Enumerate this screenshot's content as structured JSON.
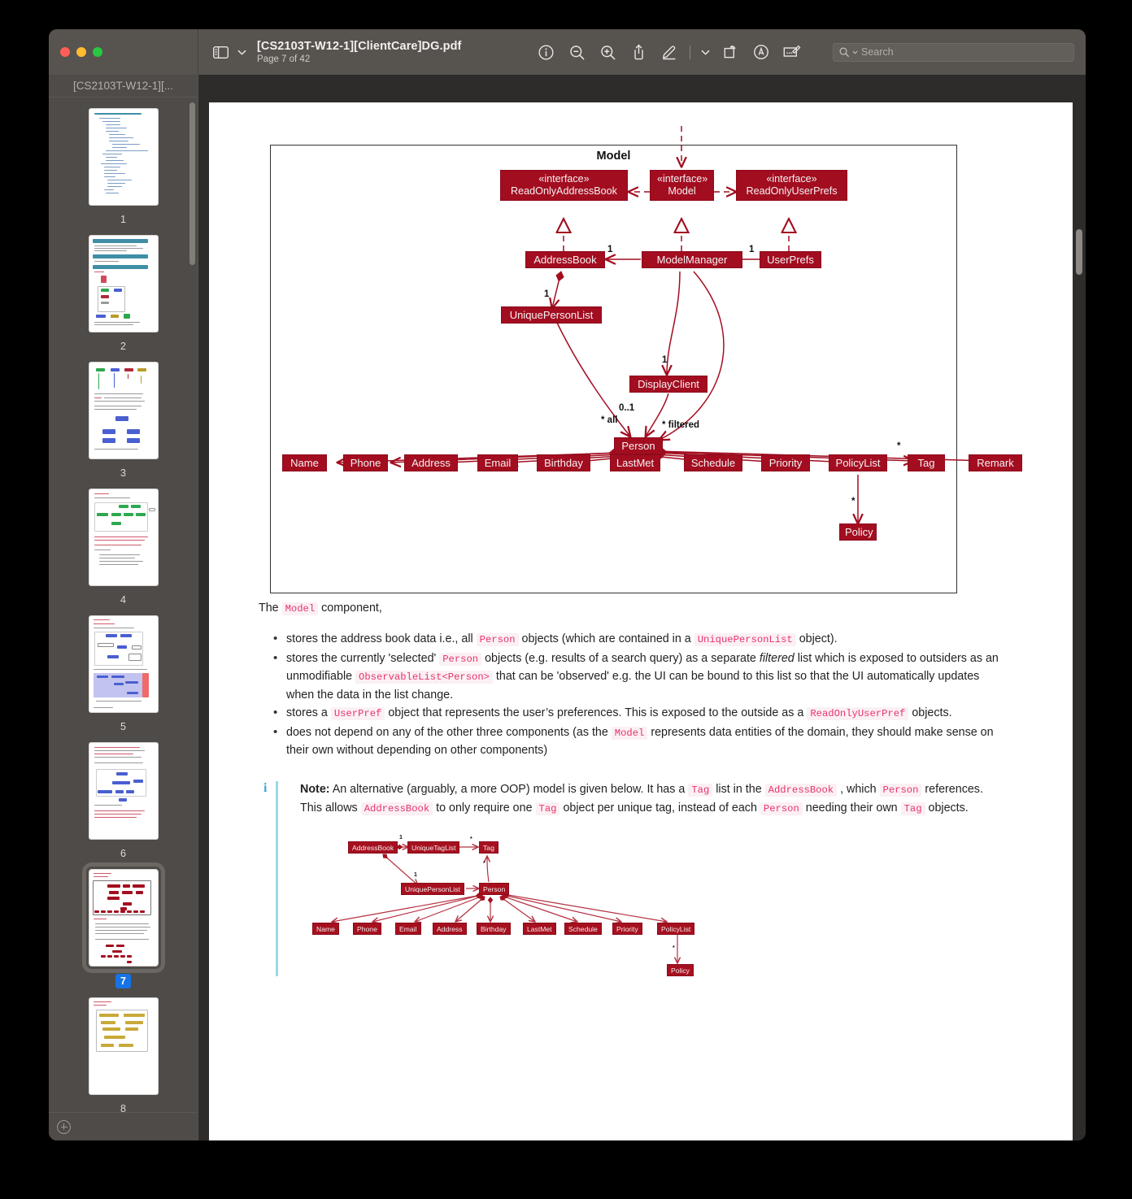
{
  "window": {
    "traffic_lights": [
      "close",
      "minimize",
      "maximize"
    ],
    "sidebar_title": "[CS2103T-W12-1][...",
    "doc_title": "[CS2103T-W12-1][ClientCare]DG.pdf",
    "page_indicator": "Page 7 of 42",
    "search_placeholder": "Search",
    "toolbar_icons": [
      "sidebar-toggle-icon",
      "chevron-down-icon",
      "info-icon",
      "zoom-out-icon",
      "zoom-in-icon",
      "share-icon",
      "markup-highlight-icon",
      "chevron-down-icon",
      "rotate-icon",
      "annotate-icon",
      "sign-icon"
    ],
    "add-button": "add-page-button"
  },
  "sidebar": {
    "thumbnails": [
      {
        "page": "1",
        "selected": false
      },
      {
        "page": "2",
        "selected": false
      },
      {
        "page": "3",
        "selected": false
      },
      {
        "page": "4",
        "selected": false
      },
      {
        "page": "5",
        "selected": false
      },
      {
        "page": "6",
        "selected": false
      },
      {
        "page": "7",
        "selected": true
      },
      {
        "page": "8",
        "selected": false
      }
    ]
  },
  "document": {
    "diagram1": {
      "title": "Model",
      "interfaces": [
        {
          "stereotype": "«interface»",
          "name": "ReadOnlyAddressBook"
        },
        {
          "stereotype": "«interface»",
          "name": "Model"
        },
        {
          "stereotype": "«interface»",
          "name": "ReadOnlyUserPrefs"
        }
      ],
      "classes": [
        "AddressBook",
        "ModelManager",
        "UserPrefs",
        "UniquePersonList",
        "DisplayClient",
        "Person",
        "Policy"
      ],
      "attributes": [
        "Name",
        "Phone",
        "Address",
        "Email",
        "Birthday",
        "LastMet",
        "Schedule",
        "Priority",
        "PolicyList",
        "Tag",
        "Remark"
      ],
      "multiplicities": [
        {
          "label": "1",
          "near": "AddressBook"
        },
        {
          "label": "1",
          "near": "UserPrefs"
        },
        {
          "label": "1",
          "near": "UniquePersonList"
        },
        {
          "label": "1",
          "near": "DisplayClient"
        },
        {
          "label": "0..1",
          "near": "Person"
        },
        {
          "label": "* all",
          "near": "Person"
        },
        {
          "label": "* filtered",
          "near": "Person"
        },
        {
          "label": "*",
          "near": "Tag"
        },
        {
          "label": "*",
          "near": "Policy"
        }
      ]
    },
    "intro": {
      "before": "The ",
      "code": "Model",
      "after": " component,"
    },
    "bullets": [
      {
        "parts": [
          {
            "t": "text",
            "v": "stores the address book data i.e., all "
          },
          {
            "t": "code",
            "v": "Person"
          },
          {
            "t": "text",
            "v": " objects (which are contained in a "
          },
          {
            "t": "code",
            "v": "UniquePersonList"
          },
          {
            "t": "text",
            "v": " object)."
          }
        ]
      },
      {
        "parts": [
          {
            "t": "text",
            "v": "stores the currently 'selected' "
          },
          {
            "t": "code",
            "v": "Person"
          },
          {
            "t": "text",
            "v": " objects (e.g. results of a search query) as a separate "
          },
          {
            "t": "em",
            "v": "filtered"
          },
          {
            "t": "text",
            "v": " list which is exposed to outsiders as an unmodifiable "
          },
          {
            "t": "code",
            "v": "ObservableList<Person>"
          },
          {
            "t": "text",
            "v": " that can be 'observed' e.g. the UI can be bound to this list so that the UI automatically updates when the data in the list change."
          }
        ]
      },
      {
        "parts": [
          {
            "t": "text",
            "v": "stores a "
          },
          {
            "t": "code",
            "v": "UserPref"
          },
          {
            "t": "text",
            "v": " object that represents the user’s preferences. This is exposed to the outside as a "
          },
          {
            "t": "code",
            "v": "ReadOnlyUserPref"
          },
          {
            "t": "text",
            "v": " objects."
          }
        ]
      },
      {
        "parts": [
          {
            "t": "text",
            "v": "does not depend on any of the other three components (as the "
          },
          {
            "t": "code",
            "v": "Model"
          },
          {
            "t": "text",
            "v": " represents data entities of the domain, they should make sense on their own without depending on other components)"
          }
        ]
      }
    ],
    "note": {
      "icon": "info-icon",
      "parts": [
        {
          "t": "b",
          "v": "Note:"
        },
        {
          "t": "text",
          "v": " An alternative (arguably, a more OOP) model is given below. It has a "
        },
        {
          "t": "code",
          "v": "Tag"
        },
        {
          "t": "text",
          "v": " list in the "
        },
        {
          "t": "code",
          "v": "AddressBook"
        },
        {
          "t": "text",
          "v": " , which "
        },
        {
          "t": "code",
          "v": "Person"
        },
        {
          "t": "text",
          "v": " references. This allows "
        },
        {
          "t": "code",
          "v": "AddressBook"
        },
        {
          "t": "text",
          "v": " to only require one "
        },
        {
          "t": "code",
          "v": "Tag"
        },
        {
          "t": "text",
          "v": " object per unique tag, instead of each "
        },
        {
          "t": "code",
          "v": "Person"
        },
        {
          "t": "text",
          "v": " needing their own "
        },
        {
          "t": "code",
          "v": "Tag"
        },
        {
          "t": "text",
          "v": " objects."
        }
      ]
    },
    "diagram2": {
      "classes": [
        "AddressBook",
        "UniqueTagList",
        "Tag",
        "UniquePersonList",
        "Person",
        "Policy"
      ],
      "attributes": [
        "Name",
        "Phone",
        "Email",
        "Address",
        "Birthday",
        "LastMet",
        "Schedule",
        "Priority",
        "PolicyList"
      ],
      "multiplicities": [
        "1",
        "*",
        "1",
        "*",
        "*"
      ]
    }
  },
  "colors": {
    "node_fill": "#a30d20",
    "node_stroke": "#8c0a1b",
    "code_text": "#e8336d",
    "code_bg": "#fbf0f3",
    "selection_blue": "#1673e6",
    "chrome": "#57534f",
    "note_rule": "#9fd5e8"
  }
}
